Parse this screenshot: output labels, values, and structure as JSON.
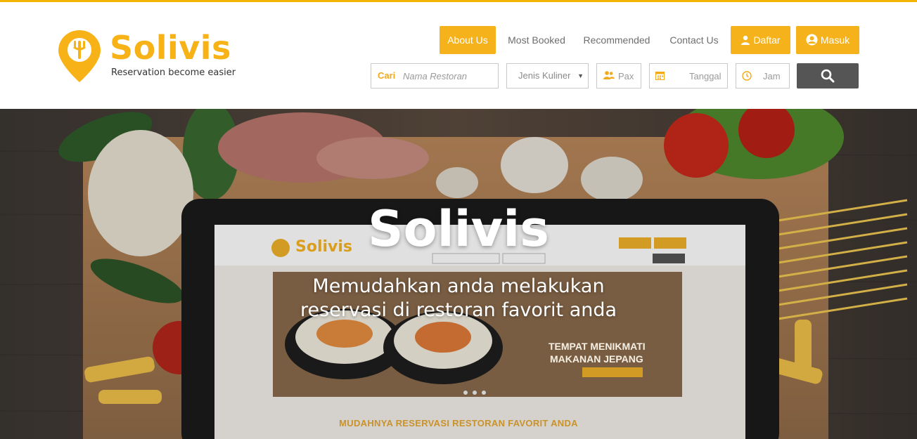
{
  "brand": {
    "name": "Solivis",
    "tagline": "Reservation become easier",
    "accent_color": "#f6b21b"
  },
  "nav": {
    "items": [
      {
        "label": "About Us",
        "active": true
      },
      {
        "label": "Most Booked",
        "active": false
      },
      {
        "label": "Recommended",
        "active": false
      },
      {
        "label": "Contact Us",
        "active": false
      }
    ],
    "register_label": "Daftar",
    "login_label": "Masuk"
  },
  "search": {
    "label": "Cari",
    "restaurant_placeholder": "Nama Restoran",
    "cuisine_selected": "Jenis Kuliner",
    "pax_placeholder": "Pax",
    "date_placeholder": "Tanggal",
    "time_placeholder": "Jam",
    "button_icon": "search-icon"
  },
  "hero": {
    "title": "Solivis",
    "subtitle_line1": "Memudahkan anda melakukan",
    "subtitle_line2": "reservasi di restoran favorit anda",
    "caption": "MUDAHNYA RESERVASI RESTORAN FAVORIT ANDA",
    "inner_logo": "Solivis",
    "inner_banner_line1": "TEMPAT MENIKMATI",
    "inner_banner_line2": "MAKANAN JEPANG"
  }
}
